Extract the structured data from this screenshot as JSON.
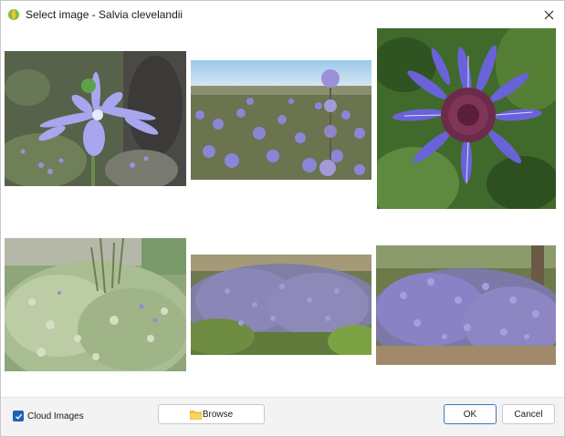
{
  "window": {
    "title": "Select image - Salvia clevelandii",
    "close_label": "✕"
  },
  "thumbnails": [
    {
      "icon": "blue-flower-closeup-photo"
    },
    {
      "icon": "flower-field-sky-photo"
    },
    {
      "icon": "purple-flower-head-photo"
    },
    {
      "icon": "green-shrub-photo"
    },
    {
      "icon": "lavender-shrub-photo"
    },
    {
      "icon": "purple-flowering-bush-photo"
    }
  ],
  "footer": {
    "cloud_images_label": "Cloud Images",
    "cloud_images_checked": true,
    "browse_label": "Browse",
    "ok_label": "OK",
    "cancel_label": "Cancel"
  },
  "colors": {
    "accent": "#1f63b8",
    "footer_bg": "#f3f3f3",
    "flower_blue": "#8f8ee8",
    "flower_purple": "#8a6fcf",
    "foliage": "#7f9a62"
  }
}
